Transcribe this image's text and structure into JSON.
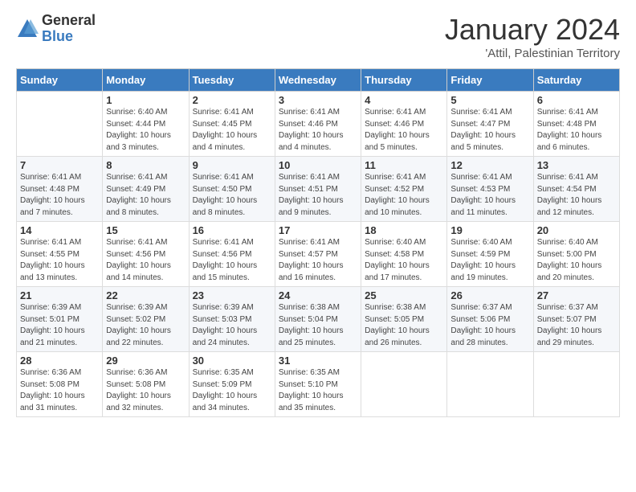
{
  "logo": {
    "general": "General",
    "blue": "Blue"
  },
  "title": "January 2024",
  "location": "'Attil, Palestinian Territory",
  "days_of_week": [
    "Sunday",
    "Monday",
    "Tuesday",
    "Wednesday",
    "Thursday",
    "Friday",
    "Saturday"
  ],
  "weeks": [
    [
      {
        "day": "",
        "info": ""
      },
      {
        "day": "1",
        "info": "Sunrise: 6:40 AM\nSunset: 4:44 PM\nDaylight: 10 hours\nand 3 minutes."
      },
      {
        "day": "2",
        "info": "Sunrise: 6:41 AM\nSunset: 4:45 PM\nDaylight: 10 hours\nand 4 minutes."
      },
      {
        "day": "3",
        "info": "Sunrise: 6:41 AM\nSunset: 4:46 PM\nDaylight: 10 hours\nand 4 minutes."
      },
      {
        "day": "4",
        "info": "Sunrise: 6:41 AM\nSunset: 4:46 PM\nDaylight: 10 hours\nand 5 minutes."
      },
      {
        "day": "5",
        "info": "Sunrise: 6:41 AM\nSunset: 4:47 PM\nDaylight: 10 hours\nand 5 minutes."
      },
      {
        "day": "6",
        "info": "Sunrise: 6:41 AM\nSunset: 4:48 PM\nDaylight: 10 hours\nand 6 minutes."
      }
    ],
    [
      {
        "day": "7",
        "info": "Sunrise: 6:41 AM\nSunset: 4:48 PM\nDaylight: 10 hours\nand 7 minutes."
      },
      {
        "day": "8",
        "info": "Sunrise: 6:41 AM\nSunset: 4:49 PM\nDaylight: 10 hours\nand 8 minutes."
      },
      {
        "day": "9",
        "info": "Sunrise: 6:41 AM\nSunset: 4:50 PM\nDaylight: 10 hours\nand 8 minutes."
      },
      {
        "day": "10",
        "info": "Sunrise: 6:41 AM\nSunset: 4:51 PM\nDaylight: 10 hours\nand 9 minutes."
      },
      {
        "day": "11",
        "info": "Sunrise: 6:41 AM\nSunset: 4:52 PM\nDaylight: 10 hours\nand 10 minutes."
      },
      {
        "day": "12",
        "info": "Sunrise: 6:41 AM\nSunset: 4:53 PM\nDaylight: 10 hours\nand 11 minutes."
      },
      {
        "day": "13",
        "info": "Sunrise: 6:41 AM\nSunset: 4:54 PM\nDaylight: 10 hours\nand 12 minutes."
      }
    ],
    [
      {
        "day": "14",
        "info": "Sunrise: 6:41 AM\nSunset: 4:55 PM\nDaylight: 10 hours\nand 13 minutes."
      },
      {
        "day": "15",
        "info": "Sunrise: 6:41 AM\nSunset: 4:56 PM\nDaylight: 10 hours\nand 14 minutes."
      },
      {
        "day": "16",
        "info": "Sunrise: 6:41 AM\nSunset: 4:56 PM\nDaylight: 10 hours\nand 15 minutes."
      },
      {
        "day": "17",
        "info": "Sunrise: 6:41 AM\nSunset: 4:57 PM\nDaylight: 10 hours\nand 16 minutes."
      },
      {
        "day": "18",
        "info": "Sunrise: 6:40 AM\nSunset: 4:58 PM\nDaylight: 10 hours\nand 17 minutes."
      },
      {
        "day": "19",
        "info": "Sunrise: 6:40 AM\nSunset: 4:59 PM\nDaylight: 10 hours\nand 19 minutes."
      },
      {
        "day": "20",
        "info": "Sunrise: 6:40 AM\nSunset: 5:00 PM\nDaylight: 10 hours\nand 20 minutes."
      }
    ],
    [
      {
        "day": "21",
        "info": "Sunrise: 6:39 AM\nSunset: 5:01 PM\nDaylight: 10 hours\nand 21 minutes."
      },
      {
        "day": "22",
        "info": "Sunrise: 6:39 AM\nSunset: 5:02 PM\nDaylight: 10 hours\nand 22 minutes."
      },
      {
        "day": "23",
        "info": "Sunrise: 6:39 AM\nSunset: 5:03 PM\nDaylight: 10 hours\nand 24 minutes."
      },
      {
        "day": "24",
        "info": "Sunrise: 6:38 AM\nSunset: 5:04 PM\nDaylight: 10 hours\nand 25 minutes."
      },
      {
        "day": "25",
        "info": "Sunrise: 6:38 AM\nSunset: 5:05 PM\nDaylight: 10 hours\nand 26 minutes."
      },
      {
        "day": "26",
        "info": "Sunrise: 6:37 AM\nSunset: 5:06 PM\nDaylight: 10 hours\nand 28 minutes."
      },
      {
        "day": "27",
        "info": "Sunrise: 6:37 AM\nSunset: 5:07 PM\nDaylight: 10 hours\nand 29 minutes."
      }
    ],
    [
      {
        "day": "28",
        "info": "Sunrise: 6:36 AM\nSunset: 5:08 PM\nDaylight: 10 hours\nand 31 minutes."
      },
      {
        "day": "29",
        "info": "Sunrise: 6:36 AM\nSunset: 5:08 PM\nDaylight: 10 hours\nand 32 minutes."
      },
      {
        "day": "30",
        "info": "Sunrise: 6:35 AM\nSunset: 5:09 PM\nDaylight: 10 hours\nand 34 minutes."
      },
      {
        "day": "31",
        "info": "Sunrise: 6:35 AM\nSunset: 5:10 PM\nDaylight: 10 hours\nand 35 minutes."
      },
      {
        "day": "",
        "info": ""
      },
      {
        "day": "",
        "info": ""
      },
      {
        "day": "",
        "info": ""
      }
    ]
  ]
}
